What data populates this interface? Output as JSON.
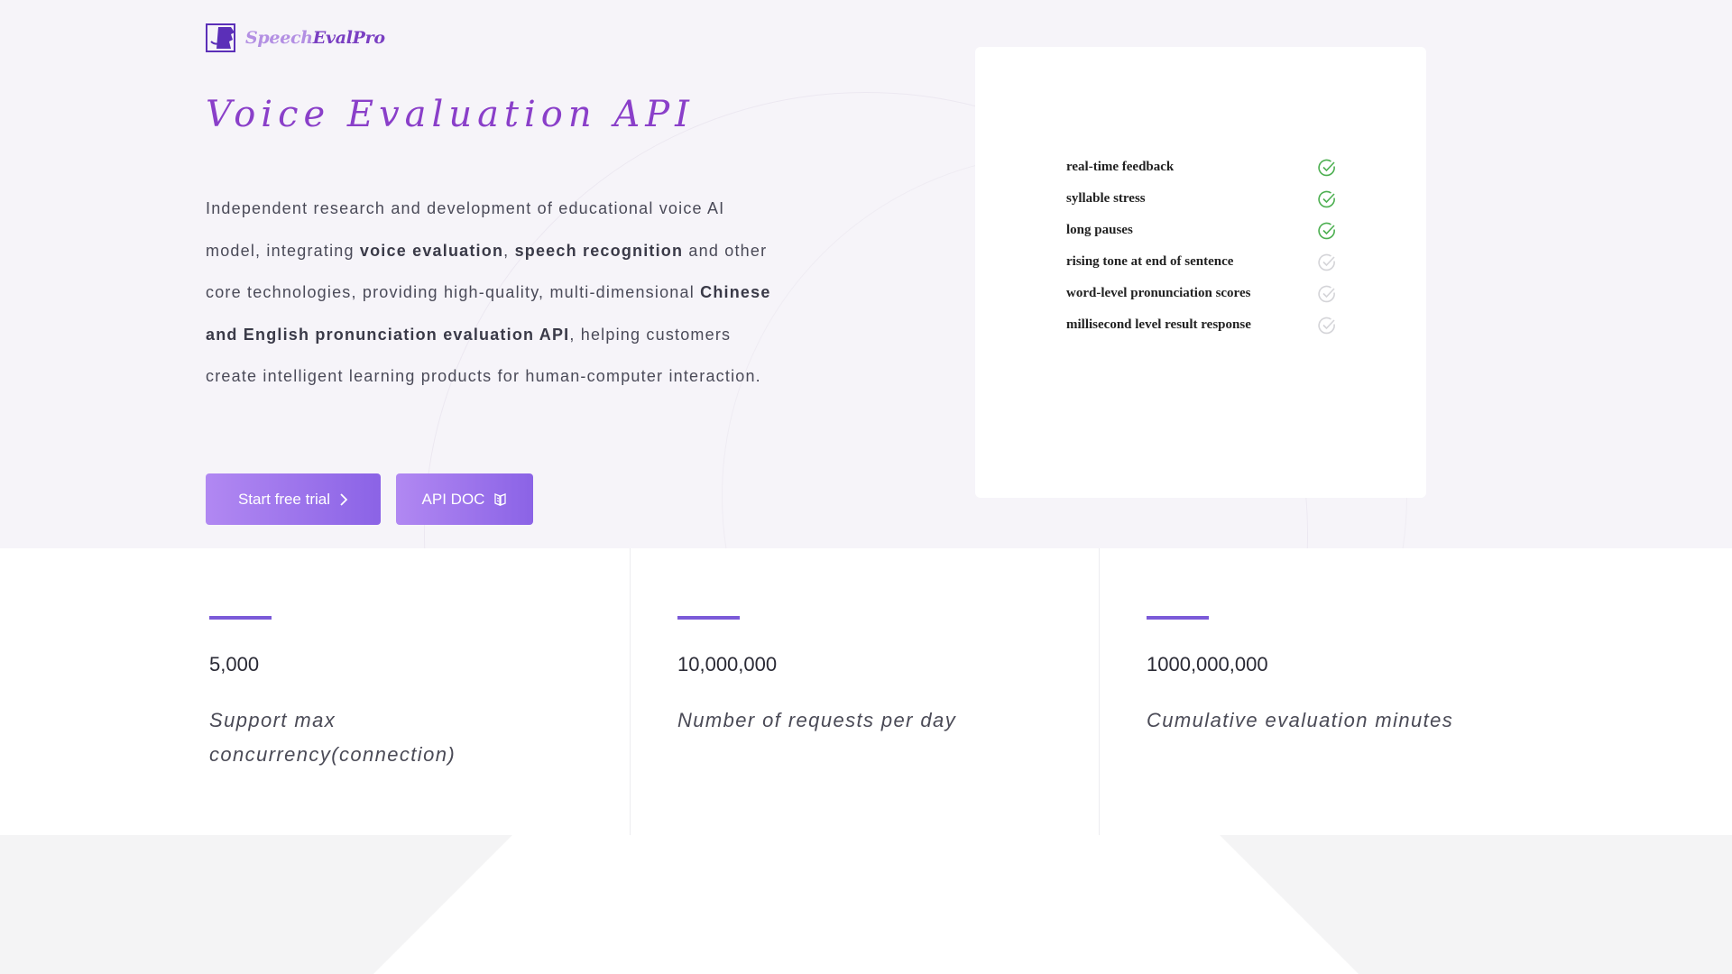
{
  "brand": {
    "name_part1": "Speech",
    "name_part2": "EvalPro",
    "accent": "#8a3fc9",
    "button_gradient": [
      "#b188f2",
      "#8b63e6"
    ]
  },
  "hero": {
    "title": "Voice Evaluation API",
    "intro": {
      "t1": "Independent research and development of educational voice AI model, integrating ",
      "b1": "voice evaluation",
      "t2": ", ",
      "b2": "speech recognition",
      "t3": " and other core technologies, providing high-quality, multi-dimensional ",
      "b3": "Chinese and English pronunciation evaluation API",
      "t4": ", helping customers create intelligent learning products for human-computer interaction."
    },
    "buttons": {
      "trial_label": "Start free trial",
      "trial_icon": "chevron-right-icon",
      "doc_label": "API DOC",
      "doc_icon": "book-icon"
    }
  },
  "features": {
    "items": [
      {
        "label": "real-time feedback",
        "checked": true
      },
      {
        "label": "syllable stress",
        "checked": true
      },
      {
        "label": "long pauses",
        "checked": true
      },
      {
        "label": "rising tone at end of sentence",
        "checked": false
      },
      {
        "label": "word-level pronunciation scores",
        "checked": false
      },
      {
        "label": "millisecond level result response",
        "checked": false
      }
    ],
    "checked_color": "#4caf50",
    "unchecked_color": "#d4d4d8"
  },
  "stats": [
    {
      "value": "5,000",
      "label": "Support max concurrency(connection)"
    },
    {
      "value": "10,000,000",
      "label": "Number of requests per day"
    },
    {
      "value": "1000,000,000",
      "label": "Cumulative evaluation minutes"
    }
  ]
}
